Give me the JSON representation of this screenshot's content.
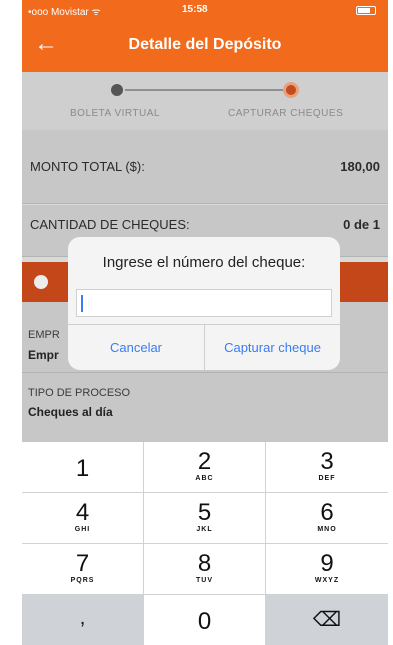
{
  "status": {
    "carrier": "•ooo Movistar ᯤ",
    "time": "15:58"
  },
  "nav": {
    "back": "←",
    "title": "Detalle del Depósito"
  },
  "stepper": {
    "step1": "BOLETA VIRTUAL",
    "step2": "CAPTURAR CHEQUES"
  },
  "rows": [
    {
      "label": "MONTO TOTAL ($):",
      "value": "180,00"
    },
    {
      "label": "CANTIDAD DE CHEQUES:",
      "value": "0 de 1"
    }
  ],
  "sections": [
    {
      "label": "EMPR",
      "value": "Empr"
    },
    {
      "label": "TIPO DE PROCESO",
      "value": "Cheques al día"
    }
  ],
  "dialog": {
    "message": "Ingrese el número del cheque:",
    "input_value": "",
    "cancel": "Cancelar",
    "confirm": "Capturar cheque"
  },
  "keypad": {
    "keys": [
      {
        "n": "1",
        "s": ""
      },
      {
        "n": "2",
        "s": "ABC"
      },
      {
        "n": "3",
        "s": "DEF"
      },
      {
        "n": "4",
        "s": "GHI"
      },
      {
        "n": "5",
        "s": "JKL"
      },
      {
        "n": "6",
        "s": "MNO"
      },
      {
        "n": "7",
        "s": "PQRS"
      },
      {
        "n": "8",
        "s": "TUV"
      },
      {
        "n": "9",
        "s": "WXYZ"
      },
      {
        "n": ",",
        "s": ""
      },
      {
        "n": "0",
        "s": ""
      },
      {
        "n": "⌫",
        "s": ""
      }
    ]
  },
  "colors": {
    "accent": "#f26a1b",
    "link": "#3b7cf4"
  }
}
